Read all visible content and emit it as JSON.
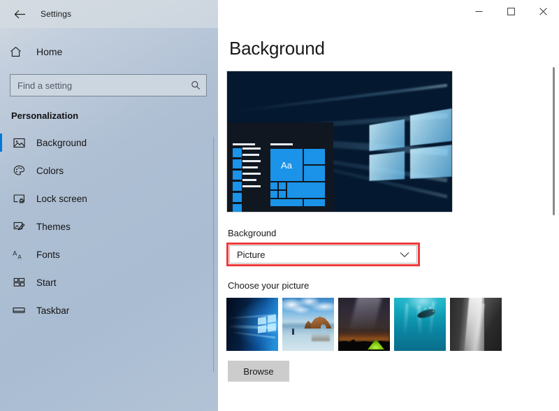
{
  "window": {
    "app_title": "Settings",
    "back_icon": "back-arrow-icon",
    "controls": {
      "minimize": "minimize-icon",
      "maximize": "maximize-icon",
      "close": "close-icon"
    }
  },
  "sidebar": {
    "home_label": "Home",
    "home_icon": "home-icon",
    "search": {
      "placeholder": "Find a setting",
      "value": "",
      "icon": "search-icon"
    },
    "section_title": "Personalization",
    "items": [
      {
        "label": "Background",
        "icon": "picture-icon",
        "selected": true
      },
      {
        "label": "Colors",
        "icon": "palette-icon",
        "selected": false
      },
      {
        "label": "Lock screen",
        "icon": "lock-screen-icon",
        "selected": false
      },
      {
        "label": "Themes",
        "icon": "themes-icon",
        "selected": false
      },
      {
        "label": "Fonts",
        "icon": "fonts-icon",
        "selected": false
      },
      {
        "label": "Start",
        "icon": "start-icon",
        "selected": false
      },
      {
        "label": "Taskbar",
        "icon": "taskbar-icon",
        "selected": false
      }
    ]
  },
  "main": {
    "page_title": "Background",
    "preview": {
      "name": "desktop-preview",
      "tile_text": "Aa"
    },
    "background_field": {
      "label": "Background",
      "selected_value": "Picture",
      "chevron_icon": "chevron-down-icon",
      "highlight_color": "#f0393c"
    },
    "choose_picture": {
      "label": "Choose your picture",
      "thumbnails": [
        {
          "name": "thumbnail-windows-hero"
        },
        {
          "name": "thumbnail-beach-rock"
        },
        {
          "name": "thumbnail-night-sky-tent"
        },
        {
          "name": "thumbnail-underwater-diver"
        },
        {
          "name": "thumbnail-waterfall-bw"
        }
      ]
    },
    "browse_button": "Browse"
  },
  "colors": {
    "accent": "#0078d7",
    "highlight": "#f0393c",
    "sidebar_top": "#d3dae1",
    "sidebar_bottom": "#aebfd3"
  }
}
